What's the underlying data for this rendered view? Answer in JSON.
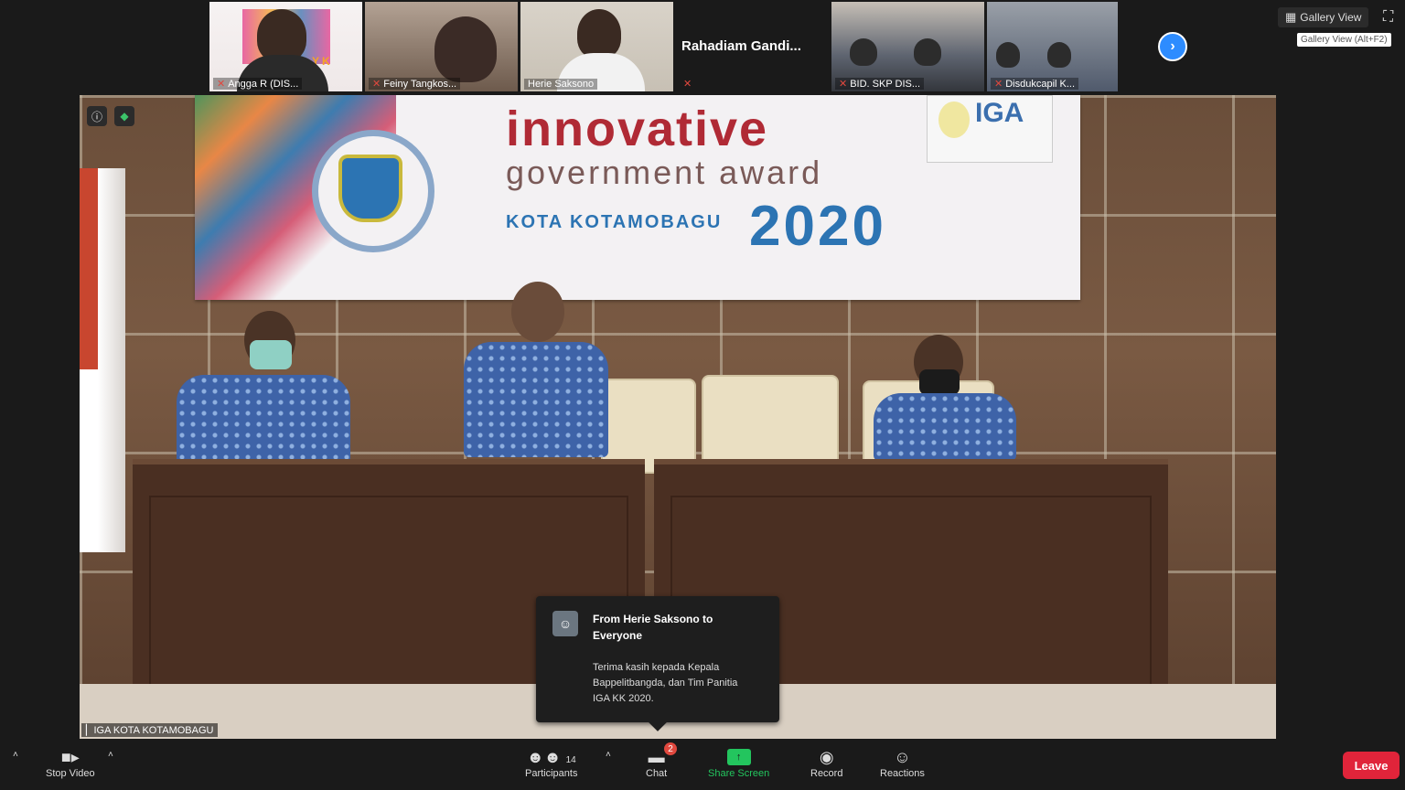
{
  "gallery": {
    "tiles": [
      {
        "name": "Angga R (DIS...",
        "has_video": true
      },
      {
        "name": "Feiny Tangkos...",
        "has_video": true
      },
      {
        "name": "Herie Saksono",
        "has_video": true
      },
      {
        "name": "Rahadiam  Gandi...",
        "has_video": false
      },
      {
        "name": "BID. SKP DIS...",
        "has_video": true
      },
      {
        "name": "Disdukcapil K...",
        "has_video": true
      }
    ],
    "tile1_logo_text": "YK"
  },
  "view_controls": {
    "gallery_view_label": "Gallery View",
    "gallery_tooltip": "Gallery View (Alt+F2)",
    "next_icon": "chevron-right-icon",
    "fullscreen_icon": "fullscreen-icon"
  },
  "main_video": {
    "participant_label": "IGA KOTA KOTAMOBAGU",
    "banner": {
      "line1": "innovative",
      "line2": "government award",
      "line3": "KOTA KOTAMOBAGU",
      "year": "2020",
      "badge": "IGA"
    }
  },
  "chat_popup": {
    "from": "From Herie Saksono to Everyone",
    "message": "Terima  kasih kepada Kepala Bappelitbangda, dan Tim Panitia  IGA KK 2020."
  },
  "toolbar": {
    "stop_video": "Stop Video",
    "participants": "Participants",
    "participant_count": "14",
    "chat": "Chat",
    "chat_unread": "2",
    "share_screen": "Share Screen",
    "record": "Record",
    "reactions": "Reactions",
    "leave": "Leave"
  },
  "colors": {
    "accent_blue": "#2d8cff",
    "share_green": "#23c55e",
    "leave_red": "#e0243a",
    "toolbar_bg": "#1a1a1a"
  }
}
